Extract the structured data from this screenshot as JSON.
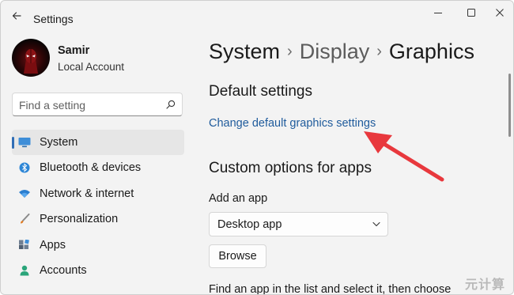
{
  "window": {
    "app_title": "Settings",
    "controls": [
      "minimize",
      "maximize",
      "close"
    ]
  },
  "user": {
    "name": "Samir",
    "account_type": "Local Account"
  },
  "search": {
    "placeholder": "Find a setting"
  },
  "sidebar": {
    "items": [
      {
        "label": "System",
        "icon": "monitor-icon",
        "selected": true
      },
      {
        "label": "Bluetooth & devices",
        "icon": "bluetooth-icon",
        "selected": false
      },
      {
        "label": "Network & internet",
        "icon": "wifi-icon",
        "selected": false
      },
      {
        "label": "Personalization",
        "icon": "brush-icon",
        "selected": false
      },
      {
        "label": "Apps",
        "icon": "apps-icon",
        "selected": false
      },
      {
        "label": "Accounts",
        "icon": "person-icon",
        "selected": false
      }
    ]
  },
  "breadcrumb": {
    "items": [
      "System",
      "Display"
    ],
    "current": "Graphics",
    "separator": "›"
  },
  "main": {
    "default_section_title": "Default settings",
    "default_link": "Change default graphics settings",
    "custom_section_title": "Custom options for apps",
    "add_app_label": "Add an app",
    "app_type_selected": "Desktop app",
    "browse_label": "Browse",
    "helper_text": "Find an app in the list and select it, then choose"
  },
  "watermark": "元计算",
  "colors": {
    "accent": "#2f6db5",
    "link": "#1f5b9c",
    "annotation_arrow": "#e8383d"
  }
}
